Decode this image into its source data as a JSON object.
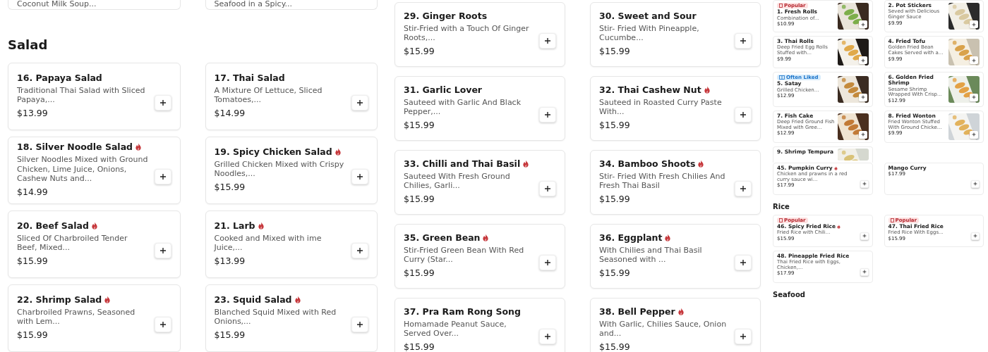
{
  "left_panel": {
    "top_cards": [
      {
        "description": "Coconut Milk Soup..."
      },
      {
        "description": "Seafood in a Spicy..."
      }
    ],
    "sections": [
      {
        "title": "Salad",
        "items": [
          {
            "name": "16. Papaya Salad",
            "spicy": false,
            "description": "Traditional Thai Salad with Sliced Papaya,...",
            "price": "$13.99"
          },
          {
            "name": "17. Thai Salad",
            "spicy": false,
            "description": "A Mixture Of Lettuce, Sliced Tomatoes,...",
            "price": "$14.99"
          },
          {
            "name": "18. Silver Noodle Salad",
            "spicy": true,
            "description": "Silver Noodles Mixed with Ground Chicken, Lime Juice, Onions, Cashew Nuts and...",
            "price": "$14.99"
          },
          {
            "name": "19. Spicy Chicken Salad",
            "spicy": true,
            "description": "Grilled Chicken Mixed with Crispy Noodles,...",
            "price": "$15.99"
          },
          {
            "name": "20. Beef Salad",
            "spicy": true,
            "description": "Sliced Of Charbroiled Tender Beef, Mixed...",
            "price": "$15.99"
          },
          {
            "name": "21. Larb",
            "spicy": true,
            "description": "Cooked and Mixed with ime Juice,...",
            "price": "$13.99"
          },
          {
            "name": "22. Shrimp Salad",
            "spicy": true,
            "description": "Charbroiled Prawns, Seasoned with Lem...",
            "price": "$15.99"
          },
          {
            "name": "23. Squid Salad",
            "spicy": true,
            "description": "Blanched Squid Mixed with Red Onions,...",
            "price": "$15.99"
          }
        ]
      }
    ]
  },
  "middle_panel": {
    "items": [
      {
        "name": "29. Ginger Roots",
        "spicy": false,
        "description": "Stir-Fried with a Touch Of Ginger Roots,...",
        "price": "$15.99"
      },
      {
        "name": "30. Sweet and Sour",
        "spicy": false,
        "description": "Stir- Fried With Pineapple, Cucumbe...",
        "price": "$15.99"
      },
      {
        "name": "31. Garlic Lover",
        "spicy": false,
        "description": "Sauteed with Garlic And Black Pepper,...",
        "price": "$15.99"
      },
      {
        "name": "32. Thai Cashew Nut",
        "spicy": true,
        "description": "Sauteed in Roasted Curry Paste With...",
        "price": "$15.99"
      },
      {
        "name": "33. Chilli and Thai Basil",
        "spicy": true,
        "description": "Sauteed With Fresh Ground Chilies, Garli...",
        "price": "$15.99"
      },
      {
        "name": "34. Bamboo Shoots",
        "spicy": true,
        "description": "Stir- Fried With Fresh Chilies And Fresh Thai Basil",
        "price": "$15.99"
      },
      {
        "name": "35. Green Bean",
        "spicy": true,
        "description": "Stir-Fried Green Bean With Red Curry (Star...",
        "price": "$15.99"
      },
      {
        "name": "36. Eggplant",
        "spicy": true,
        "description": "With Chilies and Thai Basil Seasoned with ...",
        "price": "$15.99"
      },
      {
        "name": "37. Pra Ram Rong Song",
        "spicy": false,
        "description": "Homamade Peanut Sauce, Served Over...",
        "price": "$15.99"
      },
      {
        "name": "38. Bell Pepper",
        "spicy": true,
        "description": "With Garlic, Chilies Sauce, Onion and...",
        "price": "$15.99"
      }
    ]
  },
  "side_panel": {
    "items": [
      {
        "badge": {
          "kind": "popular",
          "label": "Popular"
        },
        "name": "1. Fresh Rolls",
        "spicy": false,
        "description": "Combination of...",
        "price": "$10.99"
      },
      {
        "name": "2. Pot Stickers",
        "spicy": false,
        "description": "Seved with Delicious Ginger Sauce",
        "price": "$9.99"
      },
      {
        "name": "3. Thai Rolls",
        "spicy": false,
        "description": "Deep Fried Egg Rolls Stuffed with...",
        "price": "$9.99"
      },
      {
        "name": "4. Fried Tofu",
        "spicy": false,
        "description": "Golden Fried Bean Cakes Served with a...",
        "price": "$9.99"
      },
      {
        "badge": {
          "kind": "often_liked",
          "label": "Often Liked"
        },
        "name": "5. Satay",
        "spicy": false,
        "description": "Grilled Chicken...",
        "price": "$12.99"
      },
      {
        "name": "6. Golden Fried Shrimp",
        "spicy": false,
        "description": "Sesame Shrimp Wrapped With Crisp...",
        "price": "$12.99"
      },
      {
        "name": "7. Fish Cake",
        "spicy": false,
        "description": "Deep Fried Ground Fish Mixed with Gree...",
        "price": "$12.99"
      },
      {
        "name": "8. Fried Wonton",
        "spicy": false,
        "description": "Fried Wonton Stuffed With Ground Chicke...",
        "price": "$9.99"
      },
      {
        "kind": "partial",
        "name": "9. Shrimp Tempura"
      },
      {
        "kind": "plain",
        "name": "45. Pumpkin Curry",
        "spicy": true,
        "description": "Chicken and prawns in a red curry sauce wi...",
        "price": "$17.99"
      },
      {
        "kind": "plain",
        "name": "Mango Curry",
        "spicy": false,
        "price": "$17.99"
      }
    ],
    "sections": [
      {
        "title": "Rice",
        "items": [
          {
            "kind": "plain",
            "badge": {
              "kind": "popular",
              "label": "Popular"
            },
            "name": "46. Spicy Fried Rice",
            "spicy": true,
            "description": "Fried Rice with Chili...",
            "price": "$15.99"
          },
          {
            "kind": "plain",
            "badge": {
              "kind": "popular",
              "label": "Popular"
            },
            "name": "47. Thai Fried Rice",
            "spicy": false,
            "description": "Fried Rice With Eggs...",
            "price": "$15.99"
          },
          {
            "kind": "plain",
            "name": "48. Pineapple Fried Rice",
            "spicy": false,
            "description": "Thai Fried Rice with Eggs, Chicken,...",
            "price": "$17.99"
          }
        ]
      },
      {
        "title": "Seafood"
      }
    ]
  }
}
